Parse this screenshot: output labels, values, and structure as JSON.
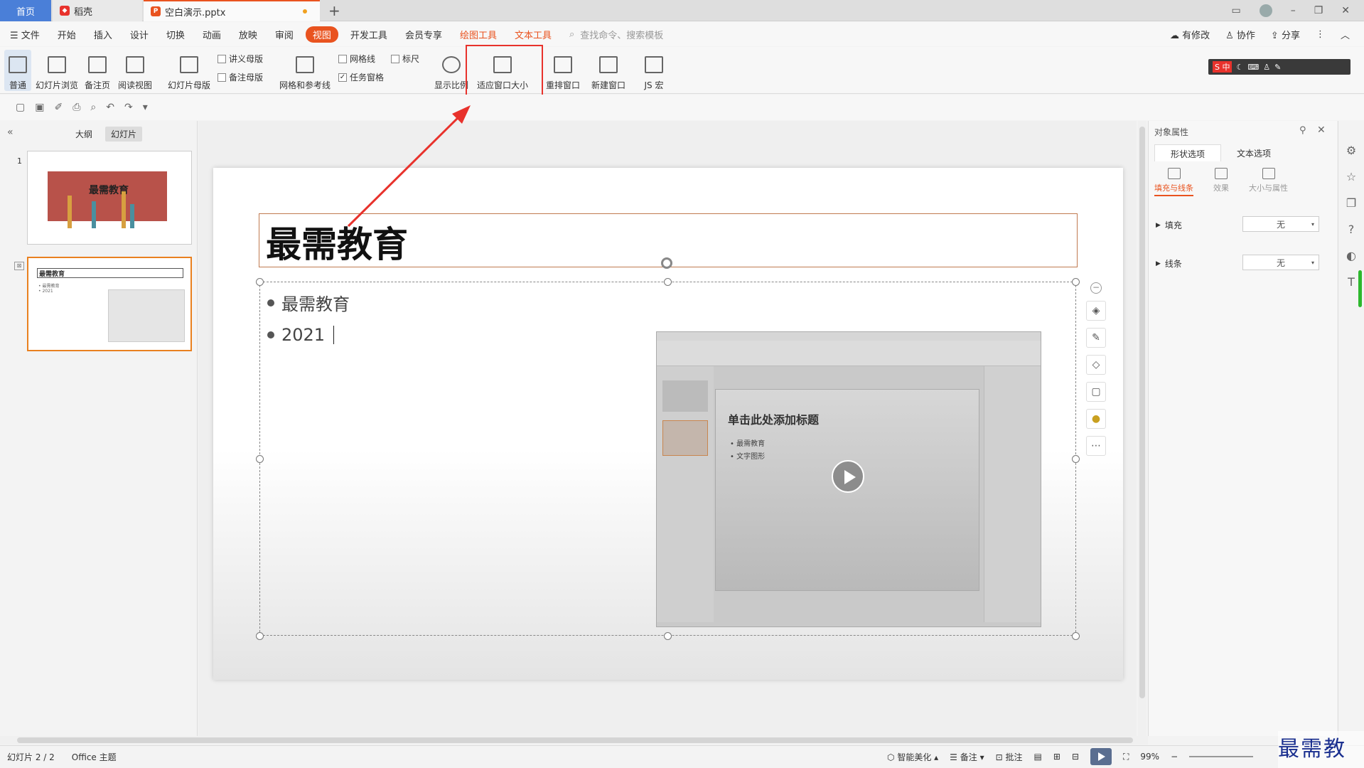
{
  "titlebar": {
    "tab_home": "首页",
    "tab_daoke": "稻壳",
    "tab_doc": "空白演示.pptx",
    "new_tab": "+",
    "minimize": "–",
    "restore": "❐",
    "close": "✕"
  },
  "menu": {
    "file": "☰ 文件",
    "items": [
      "开始",
      "插入",
      "设计",
      "切换",
      "动画",
      "放映",
      "审阅"
    ],
    "active": "视图",
    "items2": [
      "开发工具",
      "会员专享"
    ],
    "drawing_tools": "绘图工具",
    "text_tools": "文本工具",
    "search": "查找命令、搜索模板",
    "has_changes": "有修改",
    "collab": "协作",
    "share": "分享"
  },
  "ribbon": {
    "normal": "普通",
    "slide_browse": "幻灯片浏览",
    "notes_page": "备注页",
    "reading_view": "阅读视图",
    "slide_master": "幻灯片母版",
    "handout_master": "讲义母版",
    "notes_master": "备注母版",
    "grid_guides": "网格和参考线",
    "gridlines": "网格线",
    "ruler": "标尺",
    "task_pane": "任务窗格",
    "zoom": "显示比例",
    "fit_window": "适应窗口大小",
    "arrange_windows": "重排窗口",
    "new_window": "新建窗口",
    "js_macro": "JS 宏"
  },
  "ime": {
    "label": "S 中"
  },
  "left_panel": {
    "tab_outline": "大纲",
    "tab_slides": "幻灯片",
    "slide1_num": "1",
    "slide1_title": "最需教育",
    "slide2_title": "最需教育"
  },
  "slide": {
    "title": "最需教育",
    "bullets": [
      "最需教育",
      "2021"
    ]
  },
  "video": {
    "title": "单击此处添加标题",
    "bullet1": "• 最需教育",
    "bullet2": "• 文字图形"
  },
  "right_panel": {
    "title": "对象属性",
    "tab_shape": "形状选项",
    "tab_text": "文本选项",
    "sub_fill_line": "填充与线条",
    "sub_effect": "效果",
    "sub_size": "大小与属性",
    "fill_label": "填充",
    "fill_value": "无",
    "line_label": "线条",
    "line_value": "无"
  },
  "status": {
    "slide_count": "幻灯片 2 / 2",
    "theme": "Office 主题",
    "smart_beautify": "智能美化",
    "notes": "备注",
    "comments": "批注",
    "zoom": "99%"
  },
  "watermark": "最需教育",
  "colors": {
    "accent": "#e9531f",
    "home_tab": "#4a7fd8",
    "highlight_box": "#e8322c",
    "arrow": "#e8322c"
  }
}
